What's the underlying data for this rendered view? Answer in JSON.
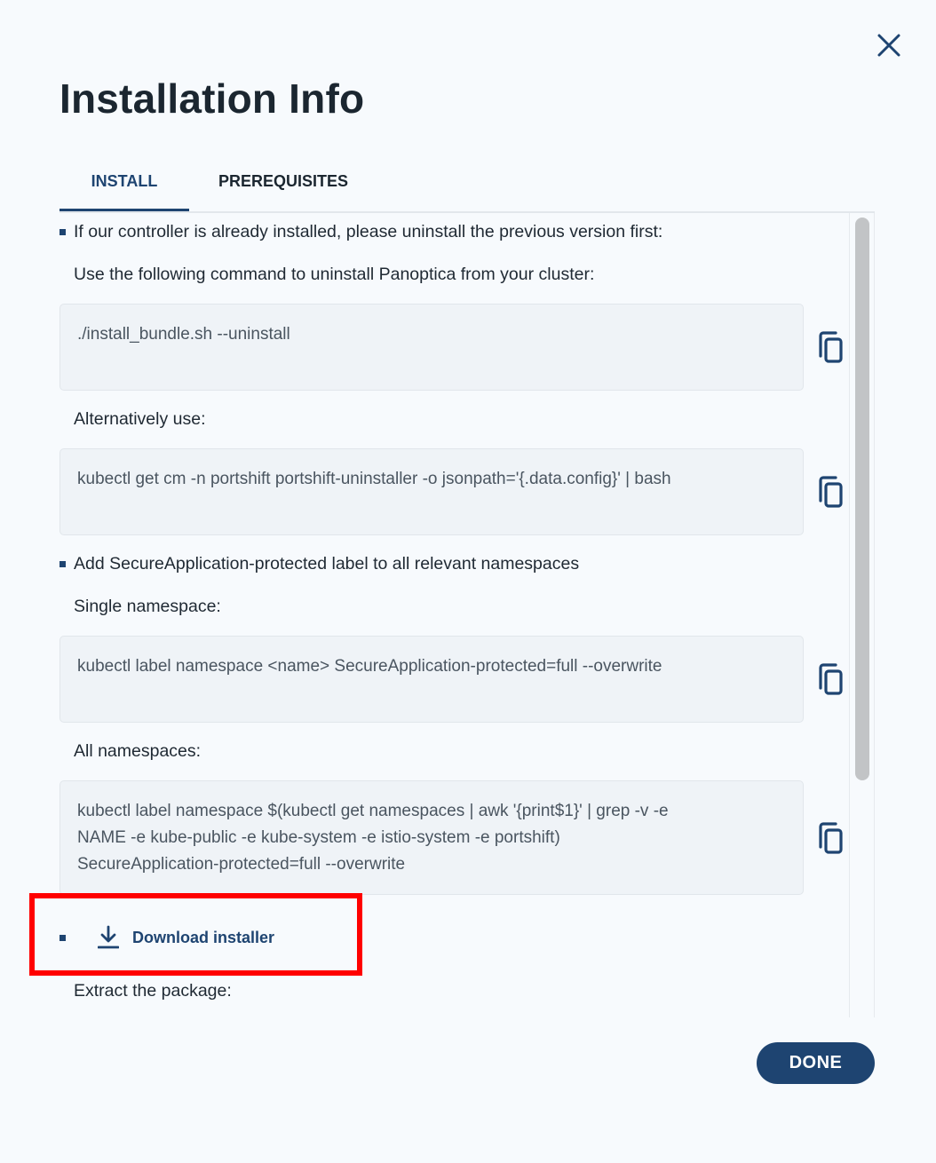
{
  "dialog": {
    "title": "Installation Info",
    "close_icon": "close-icon"
  },
  "tabs": [
    {
      "label": "INSTALL",
      "active": true
    },
    {
      "label": "PREREQUISITES",
      "active": false
    }
  ],
  "sections": {
    "uninstall": {
      "bullet_text": "If our controller is already installed, please uninstall the previous version first:",
      "instruction": "Use the following command to uninstall Panoptica from your cluster:",
      "command": "./install_bundle.sh --uninstall",
      "alt_label": "Alternatively use:",
      "alt_command": "kubectl get cm -n portshift portshift-uninstaller -o jsonpath='{.data.config}' | bash"
    },
    "label": {
      "bullet_text": "Add SecureApplication-protected label to all relevant namespaces",
      "single_label": "Single namespace:",
      "single_command": "kubectl label namespace <name> SecureApplication-protected=full --overwrite",
      "all_label": "All namespaces:",
      "all_command_lines": [
        "kubectl label namespace $(kubectl get namespaces | awk '{print$1}' | grep -v -e",
        "NAME -e kube-public -e kube-system -e istio-system -e portshift)",
        "SecureApplication-protected=full --overwrite"
      ]
    },
    "download": {
      "link_label": "Download installer",
      "icon": "download-icon",
      "extract_label": "Extract the package:"
    }
  },
  "copy_icon": "copy-icon",
  "footer": {
    "done_label": "DONE"
  },
  "colors": {
    "accent": "#1e4471",
    "background": "#f7fafd",
    "code_background": "#eff3f7",
    "highlight": "#ff0000"
  }
}
